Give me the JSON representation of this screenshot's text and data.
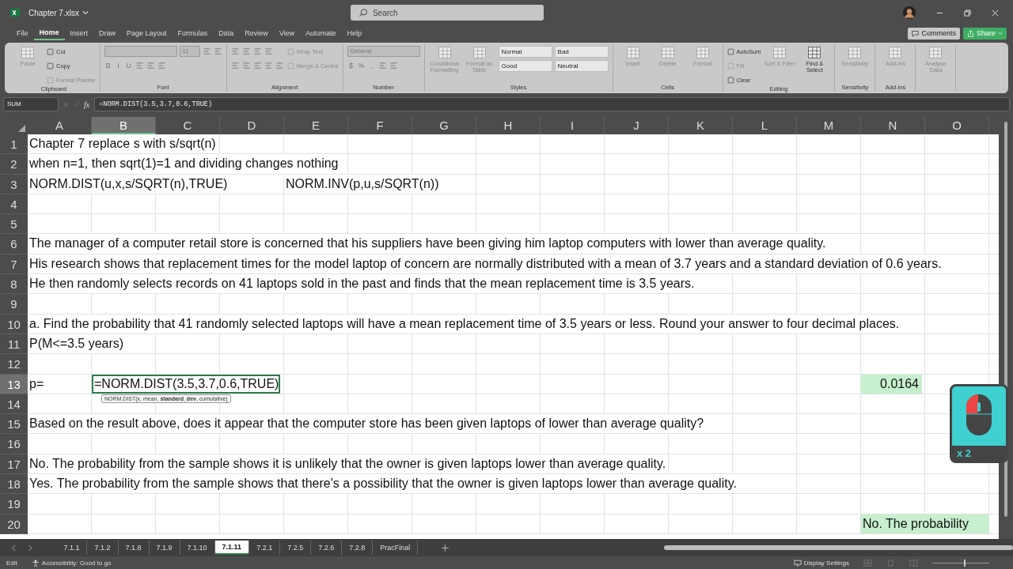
{
  "window": {
    "title": "Chapter 7.xlsx",
    "search_placeholder": "Search"
  },
  "menu_tabs": [
    {
      "label": "File",
      "selected": false
    },
    {
      "label": "Home",
      "selected": true
    },
    {
      "label": "Insert",
      "selected": false
    },
    {
      "label": "Draw",
      "selected": false
    },
    {
      "label": "Page Layout",
      "selected": false
    },
    {
      "label": "Formulas",
      "selected": false
    },
    {
      "label": "Data",
      "selected": false
    },
    {
      "label": "Review",
      "selected": false
    },
    {
      "label": "View",
      "selected": false
    },
    {
      "label": "Automate",
      "selected": false
    },
    {
      "label": "Help",
      "selected": false
    }
  ],
  "header_buttons": {
    "comments": "Comments",
    "share": "Share"
  },
  "ribbon": {
    "groups": [
      {
        "label": "Clipboard",
        "columns": [
          {
            "kind": "large",
            "label": "Paste",
            "disabled": true
          },
          {
            "kind": "stack",
            "rows": [
              [
                {
                  "kind": "small",
                  "label": "Cut",
                  "disabled": false
                }
              ],
              [
                {
                  "kind": "small",
                  "label": "Copy",
                  "disabled": false
                }
              ],
              [
                {
                  "kind": "small",
                  "label": "Format Painter",
                  "disabled": true
                }
              ]
            ]
          }
        ]
      },
      {
        "label": "Font",
        "columns": [
          {
            "kind": "stack",
            "rows": [
              [
                {
                  "kind": "field",
                  "wide": true
                },
                {
                  "kind": "field",
                  "value": "11"
                },
                {
                  "kind": "icon"
                },
                {
                  "kind": "icon"
                }
              ],
              [
                {
                  "kind": "glyph",
                  "text": "B"
                },
                {
                  "kind": "glyph",
                  "text": "I"
                },
                {
                  "kind": "glyph",
                  "text": "U"
                },
                {
                  "kind": "icon"
                },
                {
                  "kind": "icon"
                },
                {
                  "kind": "icon"
                }
              ]
            ]
          }
        ]
      },
      {
        "label": "Alignment",
        "columns": [
          {
            "kind": "stack",
            "rows": [
              [
                {
                  "kind": "icon"
                },
                {
                  "kind": "icon"
                },
                {
                  "kind": "icon"
                },
                {
                  "kind": "icon"
                }
              ],
              [
                {
                  "kind": "icon"
                },
                {
                  "kind": "icon"
                },
                {
                  "kind": "icon"
                },
                {
                  "kind": "icon"
                },
                {
                  "kind": "icon"
                }
              ]
            ]
          },
          {
            "kind": "stack",
            "rows": [
              [
                {
                  "kind": "small",
                  "label": "Wrap Text",
                  "disabled": true
                }
              ],
              [
                {
                  "kind": "small",
                  "label": "Merge & Centre",
                  "disabled": true
                }
              ]
            ]
          }
        ]
      },
      {
        "label": "Number",
        "columns": [
          {
            "kind": "stack",
            "rows": [
              [
                {
                  "kind": "field",
                  "value": "General",
                  "wide": true
                }
              ],
              [
                {
                  "kind": "glyph",
                  "text": "$"
                },
                {
                  "kind": "glyph",
                  "text": "%"
                },
                {
                  "kind": "glyph",
                  "text": ","
                },
                {
                  "kind": "icon"
                },
                {
                  "kind": "icon"
                }
              ]
            ]
          }
        ]
      },
      {
        "label": "Styles",
        "columns": [
          {
            "kind": "large",
            "label": "Conditional Formatting",
            "disabled": true
          },
          {
            "kind": "large",
            "label": "Format as Table",
            "disabled": true
          },
          {
            "kind": "stack",
            "rows": [
              [
                {
                  "kind": "style",
                  "label": "Normal"
                },
                {
                  "kind": "style",
                  "label": "Bad"
                }
              ],
              [
                {
                  "kind": "style",
                  "label": "Good"
                },
                {
                  "kind": "style",
                  "label": "Neutral"
                }
              ]
            ]
          }
        ]
      },
      {
        "label": "Cells",
        "columns": [
          {
            "kind": "large",
            "label": "Insert",
            "disabled": true
          },
          {
            "kind": "large",
            "label": "Delete",
            "disabled": true
          },
          {
            "kind": "large",
            "label": "Format",
            "disabled": true
          }
        ]
      },
      {
        "label": "Editing",
        "columns": [
          {
            "kind": "stack",
            "rows": [
              [
                {
                  "kind": "small",
                  "label": "AutoSum",
                  "disabled": false
                }
              ],
              [
                {
                  "kind": "small",
                  "label": "Fill",
                  "disabled": true
                }
              ],
              [
                {
                  "kind": "small",
                  "label": "Clear",
                  "disabled": false
                }
              ]
            ]
          },
          {
            "kind": "large",
            "label": "Sort & Filter",
            "disabled": true
          },
          {
            "kind": "large",
            "label": "Find & Select",
            "disabled": false
          }
        ]
      },
      {
        "label": "Sensitivity",
        "columns": [
          {
            "kind": "large",
            "label": "Sensitivity",
            "disabled": true
          }
        ]
      },
      {
        "label": "Add-ins",
        "columns": [
          {
            "kind": "large",
            "label": "Add-ins",
            "disabled": true
          }
        ]
      },
      {
        "columns": [
          {
            "kind": "large",
            "label": "Analyse Data",
            "disabled": true
          }
        ]
      }
    ]
  },
  "formula_bar": {
    "name_box": "SUM",
    "fx": "fx",
    "formula": "=NORM.DIST(3.5,3.7,0.6,TRUE)"
  },
  "columns": [
    {
      "label": "A",
      "selected": false
    },
    {
      "label": "B",
      "selected": true
    },
    {
      "label": "C",
      "selected": false
    },
    {
      "label": "D",
      "selected": false
    },
    {
      "label": "E",
      "selected": false
    },
    {
      "label": "F",
      "selected": false
    },
    {
      "label": "G",
      "selected": false
    },
    {
      "label": "H",
      "selected": false
    },
    {
      "label": "I",
      "selected": false
    },
    {
      "label": "J",
      "selected": false
    },
    {
      "label": "K",
      "selected": false
    },
    {
      "label": "L",
      "selected": false
    },
    {
      "label": "M",
      "selected": false
    },
    {
      "label": "N",
      "selected": false
    },
    {
      "label": "O",
      "selected": false
    }
  ],
  "rows": [
    {
      "number": "1",
      "selected": false,
      "cells": {
        "A": {
          "text": "Chapter 7 replace s with s/sqrt(n)",
          "highlighted": false,
          "active": false
        }
      }
    },
    {
      "number": "2",
      "selected": false,
      "cells": {
        "A": {
          "text": "when n=1, then sqrt(1)=1 and dividing changes nothing",
          "highlighted": false,
          "active": false
        }
      }
    },
    {
      "number": "3",
      "selected": false,
      "cells": {
        "A": {
          "text": "NORM.DIST(u,x,s/SQRT(n),TRUE)",
          "highlighted": false,
          "active": false
        },
        "E": {
          "text": "NORM.INV(p,u,s/SQRT(n))",
          "highlighted": false,
          "active": false
        }
      }
    },
    {
      "number": "4",
      "selected": false
    },
    {
      "number": "5",
      "selected": false
    },
    {
      "number": "6",
      "selected": false,
      "cells": {
        "A": {
          "text": "The manager of a computer retail store is concerned that his suppliers have been giving him laptop computers with lower than average quality.",
          "highlighted": false,
          "active": false
        }
      }
    },
    {
      "number": "7",
      "selected": false,
      "cells": {
        "A": {
          "text": "His research shows that replacement times for the model laptop of concern are normally distributed with a mean of 3.7 years and a standard deviation of 0.6 years.",
          "highlighted": false,
          "active": false
        }
      }
    },
    {
      "number": "8",
      "selected": false,
      "cells": {
        "A": {
          "text": "He then randomly selects records on 41 laptops sold in the past and finds that the mean replacement time is 3.5 years.",
          "highlighted": false,
          "active": false
        }
      }
    },
    {
      "number": "9",
      "selected": false
    },
    {
      "number": "10",
      "selected": false,
      "cells": {
        "A": {
          "text": "a. Find the probability that 41 randomly selected laptops will have a mean replacement time of 3.5 years or less. Round your answer to four decimal places.",
          "highlighted": false,
          "active": false
        }
      }
    },
    {
      "number": "11",
      "selected": false,
      "cells": {
        "A": {
          "text": "P(M<=3.5 years)",
          "highlighted": false,
          "active": false
        }
      }
    },
    {
      "number": "12",
      "selected": false
    },
    {
      "number": "13",
      "selected": true,
      "cells": {
        "A": {
          "text": "p=",
          "highlighted": false,
          "active": false
        },
        "B": {
          "text": "=NORM.DIST(3.5,3.7,0.6,TRUE)",
          "highlighted": false,
          "active": true,
          "tooltip": "NORM.DIST(x, mean, **standard_dev**, cumulative)"
        },
        "N": {
          "text": "0.0164",
          "kind": "number",
          "highlighted": true,
          "active": false
        }
      }
    },
    {
      "number": "14",
      "selected": false
    },
    {
      "number": "15",
      "selected": false,
      "cells": {
        "A": {
          "text": "Based on the result above, does it appear that the computer store has been given laptops of lower than average quality?",
          "highlighted": false,
          "active": false
        }
      }
    },
    {
      "number": "16",
      "selected": false
    },
    {
      "number": "17",
      "selected": false,
      "cells": {
        "A": {
          "text": "No. The probability from the sample shows it is unlikely that the owner is given laptops lower than average quality.",
          "highlighted": false,
          "active": false
        }
      }
    },
    {
      "number": "18",
      "selected": false,
      "cells": {
        "A": {
          "text": "Yes. The probability from the sample shows that there's a possibility that the owner is given laptops lower than average quality.",
          "highlighted": false,
          "active": false
        }
      }
    },
    {
      "number": "19",
      "selected": false
    },
    {
      "number": "20",
      "selected": false,
      "cells": {
        "N": {
          "text": "No. The probability",
          "highlighted": true,
          "active": false
        }
      }
    }
  ],
  "click_indicator": {
    "count": "x 2"
  },
  "sheet_tabs": [
    {
      "label": "7.1.1",
      "selected": false
    },
    {
      "label": "7.1.2",
      "selected": false
    },
    {
      "label": "7.1.8",
      "selected": false
    },
    {
      "label": "7.1.9",
      "selected": false
    },
    {
      "label": "7.1.10",
      "selected": false
    },
    {
      "label": "7.1.11",
      "selected": true
    },
    {
      "label": "7.2.1",
      "selected": false
    },
    {
      "label": "7.2.5",
      "selected": false
    },
    {
      "label": "7.2.6",
      "selected": false
    },
    {
      "label": "7.2.8",
      "selected": false
    },
    {
      "label": "PracFinal",
      "selected": false
    }
  ],
  "status_bar": {
    "mode": "Edit",
    "accessibility": "Accessibility: Good to go",
    "display_settings": "Display Settings",
    "zoom": {
      "level": 0.55
    }
  }
}
